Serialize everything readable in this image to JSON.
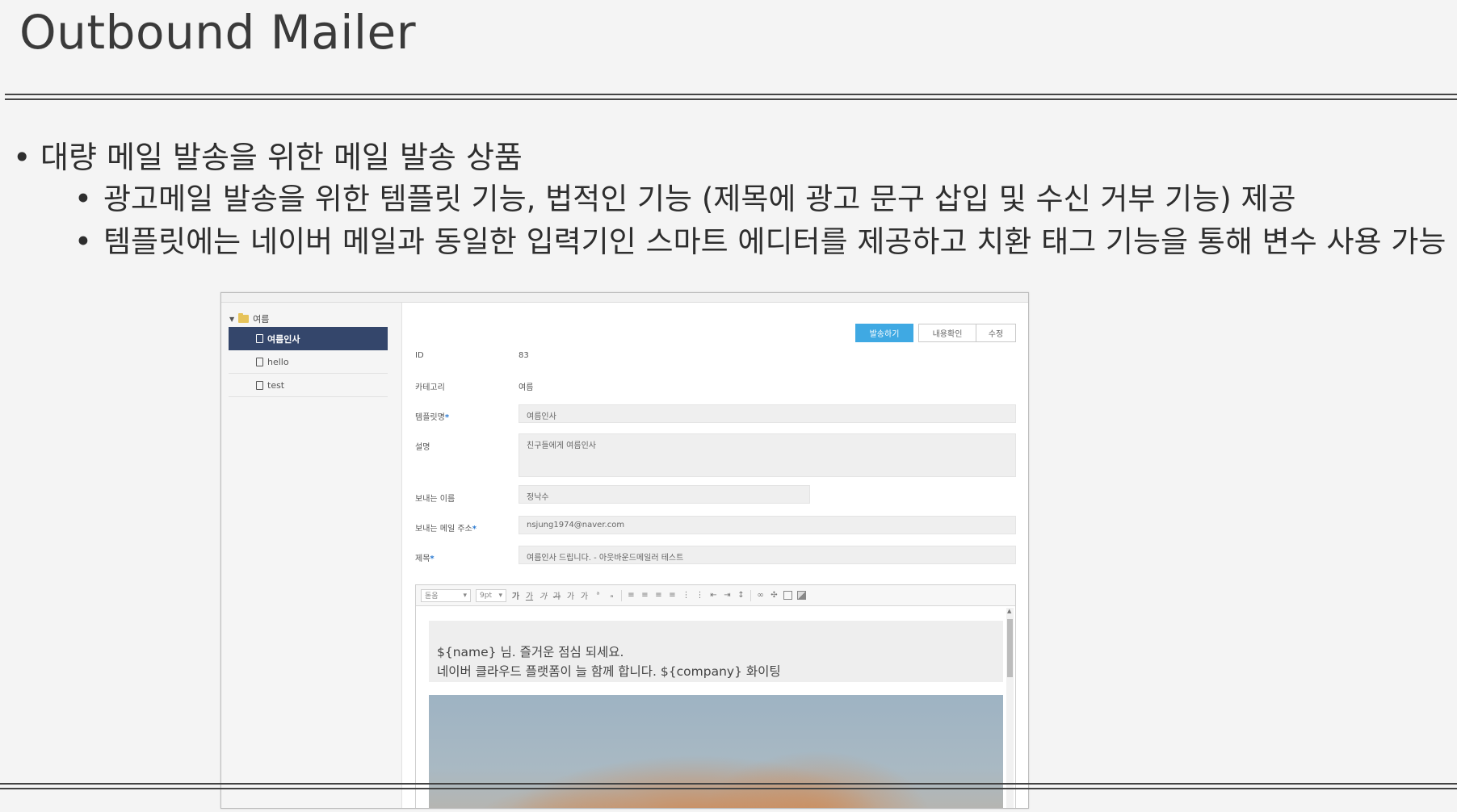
{
  "slide": {
    "title": "Outbound Mailer",
    "bullets": [
      "대량 메일 발송을 위한 메일 발송 상품",
      "광고메일 발송을 위한 템플릿 기능, 법적인 기능 (제목에 광고 문구 삽입 및 수신 거부 기능) 제공",
      "템플릿에는 네이버 메일과 동일한 입력기인 스마트 에디터를 제공하고 치환 태그 기능을 통해 변수 사용 가능"
    ]
  },
  "sidebar": {
    "folder": "여름",
    "items": [
      {
        "label": "여름인사",
        "selected": true
      },
      {
        "label": "hello",
        "selected": false
      },
      {
        "label": "test",
        "selected": false
      }
    ]
  },
  "actions": {
    "send": "발송하기",
    "view": "내용확인",
    "edit": "수정"
  },
  "form": {
    "id_label": "ID",
    "id_value": "83",
    "category_label": "카테고리",
    "category_value": "여름",
    "template_name_label": "템플릿명",
    "template_name_value": "여름인사",
    "description_label": "설명",
    "description_value": "친구들에게 여름인사",
    "sender_name_label": "보내는 이름",
    "sender_name_value": "정낙수",
    "sender_email_label": "보내는 메일 주소",
    "sender_email_value": "nsjung1974@naver.com",
    "subject_label": "제목",
    "subject_value": "여름인사 드립니다. - 아웃바운드메일러 테스트",
    "required_mark": "*"
  },
  "editor": {
    "font_select": "돋움",
    "size_select": "9pt",
    "body_line1": "${name} 님. 즐거운 점심 되세요.",
    "body_line2": "네이버 클라우드 플랫폼이 늘 함께 합니다. ${company} 화이팅"
  },
  "colors": {
    "selected_item": "#34466b",
    "primary_button": "#3fa9e3",
    "required_mark": "#2d7bd1"
  }
}
